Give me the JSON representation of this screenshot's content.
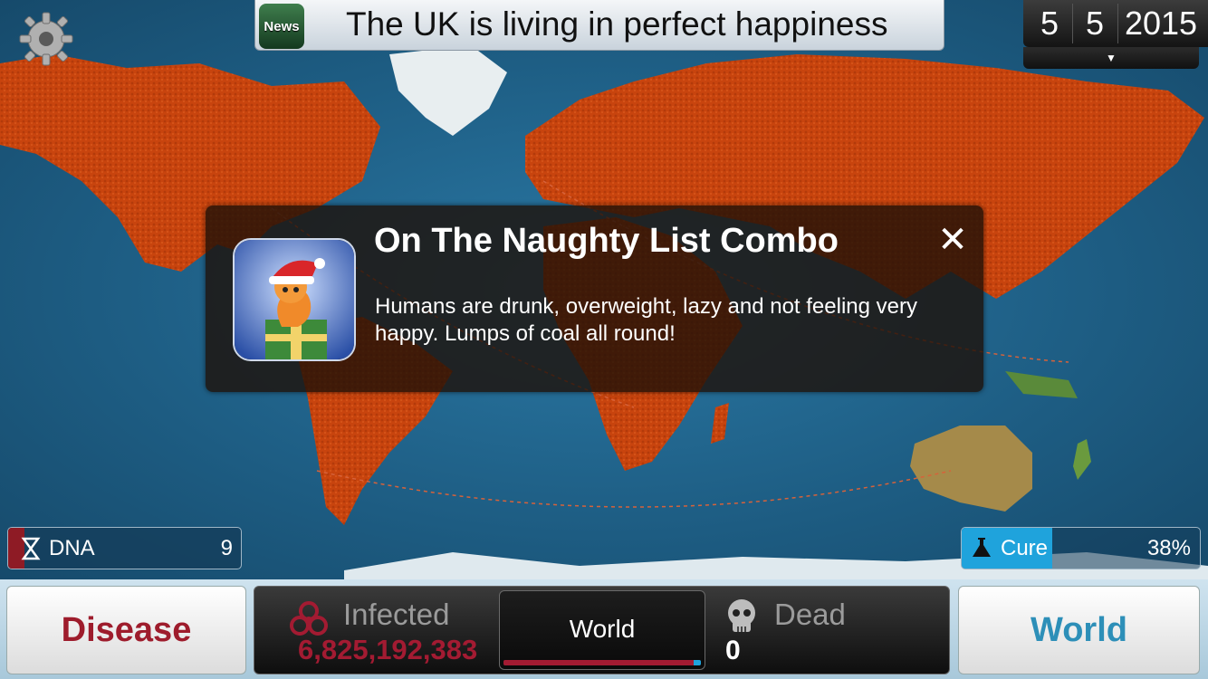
{
  "news": {
    "badge": "News",
    "headline": "The UK is living in perfect happiness"
  },
  "date": {
    "day": "5",
    "month": "5",
    "year": "2015",
    "toggle_icon": "triangle-down"
  },
  "popup": {
    "title": "On The Naughty List Combo",
    "body": "Humans are drunk, overweight, lazy and not feeling very happy. Lumps of coal all round!",
    "close_label": "✕",
    "icon": "santa-worm-icon"
  },
  "dna": {
    "label": "DNA",
    "value": "9"
  },
  "cure": {
    "label": "Cure",
    "value": "38%",
    "progress": 0.38
  },
  "bottom": {
    "disease_button": "Disease",
    "world_button": "World",
    "infected_label": "Infected",
    "infected_value": "6,825,192,383",
    "dead_label": "Dead",
    "dead_value": "0",
    "region": "World"
  },
  "colors": {
    "infected": "#a31b32",
    "cure": "#1fa3dc",
    "land_infected": "#c8440e",
    "ocean": "#1f5f86"
  }
}
